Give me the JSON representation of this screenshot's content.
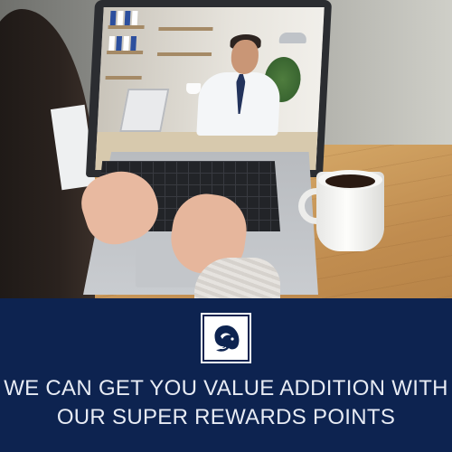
{
  "banner": {
    "headline_line1": "WE CAN GET YOU VALUE ADDITION WITH",
    "headline_line2": "OUR SUPER REWARDS POINTS",
    "logo_icon": "elephant-logo-icon"
  },
  "colors": {
    "banner_background": "#0d2350",
    "headline_text": "#e7ebf4",
    "logo_background": "#ffffff"
  }
}
